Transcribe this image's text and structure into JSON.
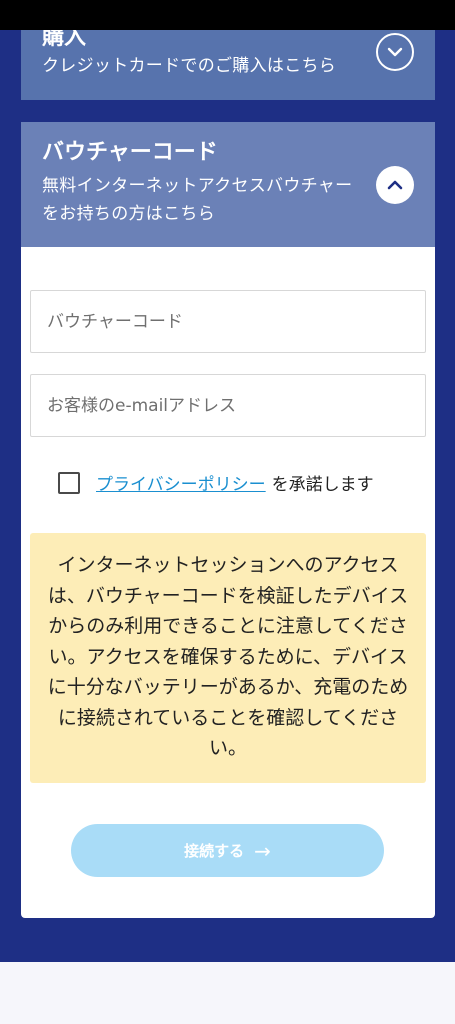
{
  "purchase_section": {
    "title": "購入",
    "subtitle": "クレジットカードでのご購入はこちら",
    "toggle_icon": "chevron-down-icon"
  },
  "voucher_section": {
    "title": "バウチャーコード",
    "subtitle": "無料インターネットアクセスバウチャーをお持ちの方はこちら",
    "toggle_icon": "chevron-up-icon",
    "code_input": {
      "placeholder": "バウチャーコード",
      "value": ""
    },
    "email_input": {
      "placeholder": "お客様のe-mailアドレス",
      "value": ""
    },
    "consent": {
      "checked": false,
      "link_text": "プライバシーポリシー",
      "suffix_text": "を承諾します"
    },
    "notice_text": "インターネットセッションへのアクセスは、バウチャーコードを検証したデバイスからのみ利用できることに注意してください。アクセスを確保するために、デバイスに十分なバッテリーがあるか、充電のために接続されていることを確認してください。",
    "connect_button": {
      "label": "接続する",
      "icon": "arrow-right-icon",
      "disabled": true
    }
  },
  "colors": {
    "page_background": "#1e2f85",
    "purchase_header": "#5773ad",
    "voucher_header": "#6b81b7",
    "notice_background": "#fdedb7",
    "link": "#1a8fd0",
    "button_disabled": "#a9dcf7"
  }
}
